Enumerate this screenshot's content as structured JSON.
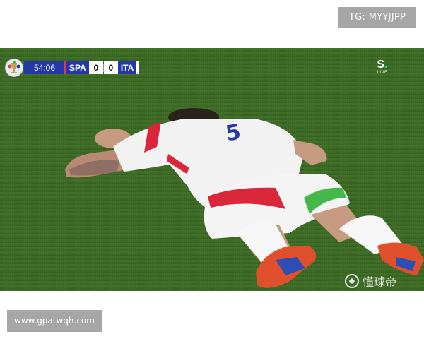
{
  "watermark_top": {
    "text": "TG: MYYJJPP"
  },
  "scoreboard": {
    "clock": "54:06",
    "home_team": "SPA",
    "home_score": "0",
    "away_score": "0",
    "away_team": "ITA",
    "logo_icon": "tournament-trophy-icon",
    "colors": {
      "bar": "#2438a8",
      "accent": "#e23b3b"
    }
  },
  "broadcaster": {
    "mark": "S",
    "sub": "LIVE",
    "dot_color": "#2ad4a0"
  },
  "source_watermark": {
    "icon": "football-icon",
    "text": "懂球帝"
  },
  "watermark_bottom": {
    "text": "www.gpatwqh.com"
  },
  "scene": {
    "jersey_number": "5",
    "colors": {
      "pitch": "#3f6f29",
      "kit": "#f3f3f3",
      "kit_trim": "#d9263a",
      "number": "#2438a8",
      "socks_band": "#45b84a"
    }
  }
}
